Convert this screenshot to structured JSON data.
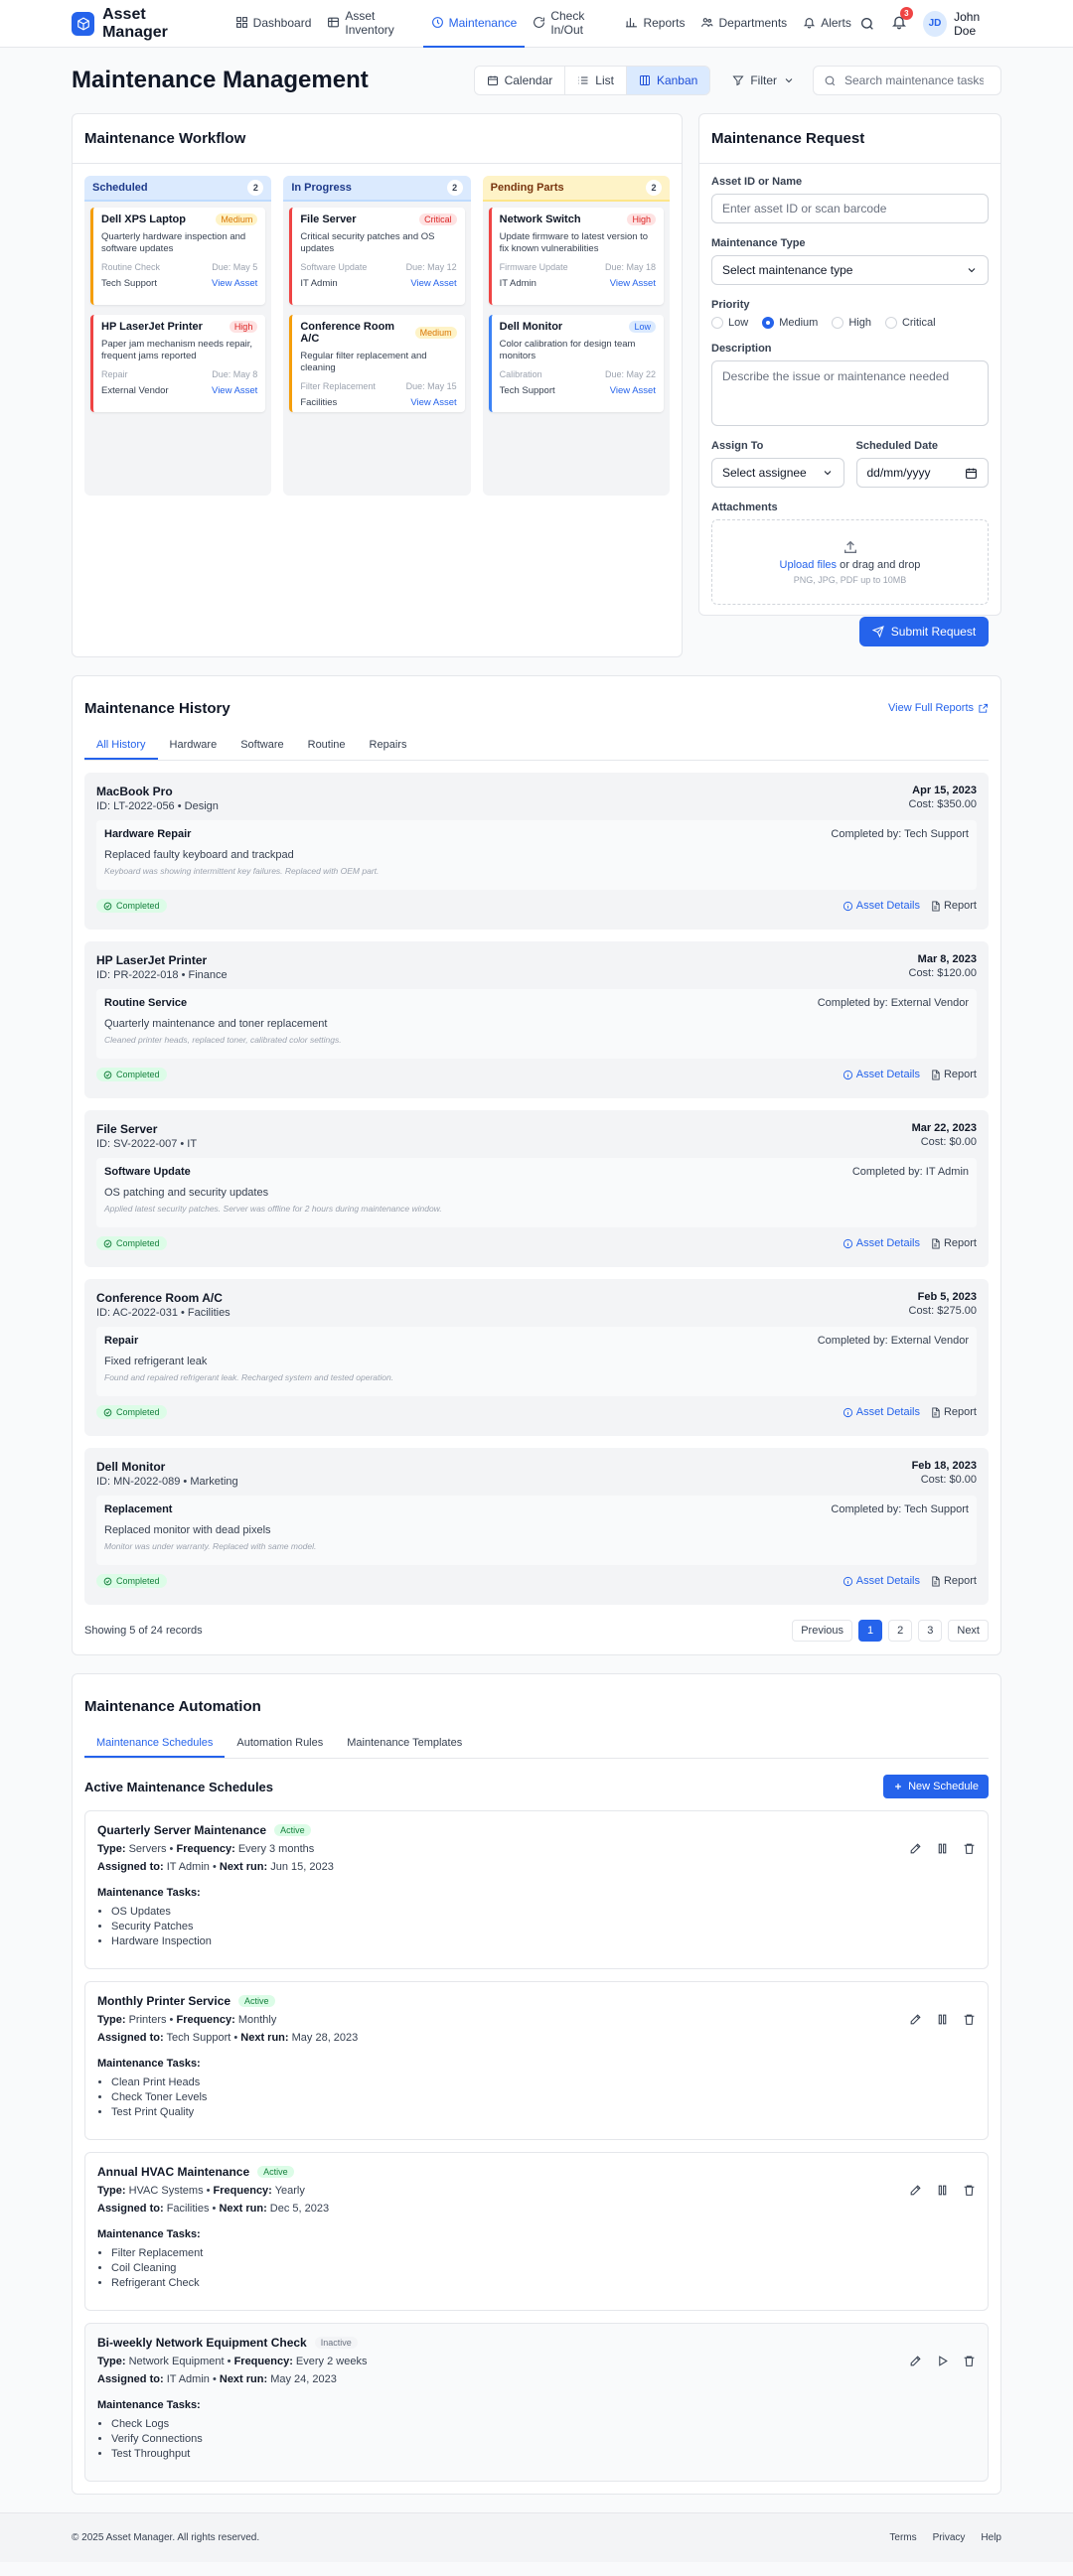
{
  "app": {
    "title": "Asset Manager"
  },
  "nav": [
    {
      "label": "Dashboard",
      "icon": "dashboard-icon"
    },
    {
      "label": "Asset Inventory",
      "icon": "inventory-icon"
    },
    {
      "label": "Maintenance",
      "icon": "maintenance-icon",
      "active": true
    },
    {
      "label": "Check In/Out",
      "icon": "checkinout-icon"
    },
    {
      "label": "Reports",
      "icon": "reports-icon"
    },
    {
      "label": "Departments",
      "icon": "departments-icon"
    },
    {
      "label": "Alerts",
      "icon": "alerts-icon"
    }
  ],
  "header": {
    "notification_count": "3",
    "user_initials": "JD",
    "user_name": "John Doe"
  },
  "page": {
    "title": "Maintenance Management"
  },
  "views": {
    "calendar": "Calendar",
    "list": "List",
    "kanban": "Kanban",
    "active": "Kanban"
  },
  "filter": {
    "label": "Filter"
  },
  "search": {
    "placeholder": "Search maintenance tasks..."
  },
  "workflow": {
    "title": "Maintenance Workflow",
    "columns": [
      {
        "title": "Scheduled",
        "count": "2",
        "cards": [
          {
            "title": "Dell XPS Laptop",
            "priority": "Medium",
            "desc": "Quarterly hardware inspection and software updates",
            "type": "Routine Check",
            "due": "Due: May 5",
            "assignee": "Tech Support",
            "link": "View Asset"
          },
          {
            "title": "HP LaserJet Printer",
            "priority": "High",
            "desc": "Paper jam mechanism needs repair, frequent jams reported",
            "type": "Repair",
            "due": "Due: May 8",
            "assignee": "External Vendor",
            "link": "View Asset"
          }
        ]
      },
      {
        "title": "In Progress",
        "count": "2",
        "cards": [
          {
            "title": "File Server",
            "priority": "Critical",
            "desc": "Critical security patches and OS updates",
            "type": "Software Update",
            "due": "Due: May 12",
            "assignee": "IT Admin",
            "link": "View Asset"
          },
          {
            "title": "Conference Room A/C",
            "priority": "Medium",
            "desc": "Regular filter replacement and cleaning",
            "type": "Filter Replacement",
            "due": "Due: May 15",
            "assignee": "Facilities",
            "link": "View Asset"
          }
        ]
      },
      {
        "title": "Pending Parts",
        "count": "2",
        "cards": [
          {
            "title": "Network Switch",
            "priority": "High",
            "desc": "Update firmware to latest version to fix known vulnerabilities",
            "type": "Firmware Update",
            "due": "Due: May 18",
            "assignee": "IT Admin",
            "link": "View Asset"
          },
          {
            "title": "Dell Monitor",
            "priority": "Low",
            "desc": "Color calibration for design team monitors",
            "type": "Calibration",
            "due": "Due: May 22",
            "assignee": "Tech Support",
            "link": "View Asset"
          }
        ]
      }
    ]
  },
  "request": {
    "title": "Maintenance Request",
    "asset_label": "Asset ID or Name",
    "asset_placeholder": "Enter asset ID or scan barcode",
    "type_label": "Maintenance Type",
    "type_value": "Select maintenance type",
    "priority_label": "Priority",
    "priorities": [
      "Low",
      "Medium",
      "High",
      "Critical"
    ],
    "priority_selected": "Medium",
    "desc_label": "Description",
    "desc_placeholder": "Describe the issue or maintenance needed",
    "assign_label": "Assign To",
    "assign_value": "Select assignee",
    "date_label": "Scheduled Date",
    "date_value": "dd/mm/yyyy",
    "attach_label": "Attachments",
    "upload_link": "Upload files",
    "upload_text": "or drag and drop",
    "upload_hint": "PNG, JPG, PDF up to 10MB",
    "submit": "Submit Request"
  },
  "history": {
    "title": "Maintenance History",
    "link": "View Full Reports",
    "tabs": [
      "All History",
      "Hardware",
      "Software",
      "Routine",
      "Repairs"
    ],
    "items": [
      {
        "name": "MacBook Pro",
        "id": "ID: LT-2022-056 • Design",
        "date": "Apr 15, 2023",
        "cost": "Cost: $350.00",
        "type": "Hardware Repair",
        "by": "Completed by: Tech Support",
        "desc": "Replaced faulty keyboard and trackpad",
        "note": "Keyboard was showing intermittent key failures. Replaced with OEM part.",
        "status": "Completed"
      },
      {
        "name": "HP LaserJet Printer",
        "id": "ID: PR-2022-018 • Finance",
        "date": "Mar 8, 2023",
        "cost": "Cost: $120.00",
        "type": "Routine Service",
        "by": "Completed by: External Vendor",
        "desc": "Quarterly maintenance and toner replacement",
        "note": "Cleaned printer heads, replaced toner, calibrated color settings.",
        "status": "Completed"
      },
      {
        "name": "File Server",
        "id": "ID: SV-2022-007 • IT",
        "date": "Mar 22, 2023",
        "cost": "Cost: $0.00",
        "type": "Software Update",
        "by": "Completed by: IT Admin",
        "desc": "OS patching and security updates",
        "note": "Applied latest security patches. Server was offline for 2 hours during maintenance window.",
        "status": "Completed"
      },
      {
        "name": "Conference Room A/C",
        "id": "ID: AC-2022-031 • Facilities",
        "date": "Feb 5, 2023",
        "cost": "Cost: $275.00",
        "type": "Repair",
        "by": "Completed by: External Vendor",
        "desc": "Fixed refrigerant leak",
        "note": "Found and repaired refrigerant leak. Recharged system and tested operation.",
        "status": "Completed"
      },
      {
        "name": "Dell Monitor",
        "id": "ID: MN-2022-089 • Marketing",
        "date": "Feb 18, 2023",
        "cost": "Cost: $0.00",
        "type": "Replacement",
        "by": "Completed by: Tech Support",
        "desc": "Replaced monitor with dead pixels",
        "note": "Monitor was under warranty. Replaced with same model.",
        "status": "Completed"
      }
    ],
    "asset_details": "Asset Details",
    "report": "Report",
    "showing": "Showing 5 of 24 records",
    "prev": "Previous",
    "pages": [
      "1",
      "2",
      "3"
    ],
    "next": "Next"
  },
  "automation": {
    "title": "Maintenance Automation",
    "tabs": [
      "Maintenance Schedules",
      "Automation Rules",
      "Maintenance Templates"
    ],
    "subtitle": "Active Maintenance Schedules",
    "new_button": "New Schedule",
    "tasks_label": "Maintenance Tasks:",
    "schedules": [
      {
        "name": "Quarterly Server Maintenance",
        "status": "Active",
        "type_label": "Type:",
        "type": "Servers",
        "freq_label": "Frequency:",
        "freq": "Every 3 months",
        "assigned_label": "Assigned to:",
        "assigned": "IT Admin",
        "next_label": "Next run:",
        "next": "Jun 15, 2023",
        "tasks": [
          "OS Updates",
          "Security Patches",
          "Hardware Inspection"
        ]
      },
      {
        "name": "Monthly Printer Service",
        "status": "Active",
        "type_label": "Type:",
        "type": "Printers",
        "freq_label": "Frequency:",
        "freq": "Monthly",
        "assigned_label": "Assigned to:",
        "assigned": "Tech Support",
        "next_label": "Next run:",
        "next": "May 28, 2023",
        "tasks": [
          "Clean Print Heads",
          "Check Toner Levels",
          "Test Print Quality"
        ]
      },
      {
        "name": "Annual HVAC Maintenance",
        "status": "Active",
        "type_label": "Type:",
        "type": "HVAC Systems",
        "freq_label": "Frequency:",
        "freq": "Yearly",
        "assigned_label": "Assigned to:",
        "assigned": "Facilities",
        "next_label": "Next run:",
        "next": "Dec 5, 2023",
        "tasks": [
          "Filter Replacement",
          "Coil Cleaning",
          "Refrigerant Check"
        ]
      },
      {
        "name": "Bi-weekly Network Equipment Check",
        "status": "Inactive",
        "type_label": "Type:",
        "type": "Network Equipment",
        "freq_label": "Frequency:",
        "freq": "Every 2 weeks",
        "assigned_label": "Assigned to:",
        "assigned": "IT Admin",
        "next_label": "Next run:",
        "next": "May 24, 2023",
        "tasks": [
          "Check Logs",
          "Verify Connections",
          "Test Throughput"
        ]
      }
    ]
  },
  "footer": {
    "copyright": "© 2025 Asset Manager. All rights reserved.",
    "links": [
      "Terms",
      "Privacy",
      "Help"
    ]
  },
  "colors": {
    "accent": "#2563eb",
    "critical": "#dc2626",
    "warning": "#d97706",
    "success": "#15803d"
  }
}
